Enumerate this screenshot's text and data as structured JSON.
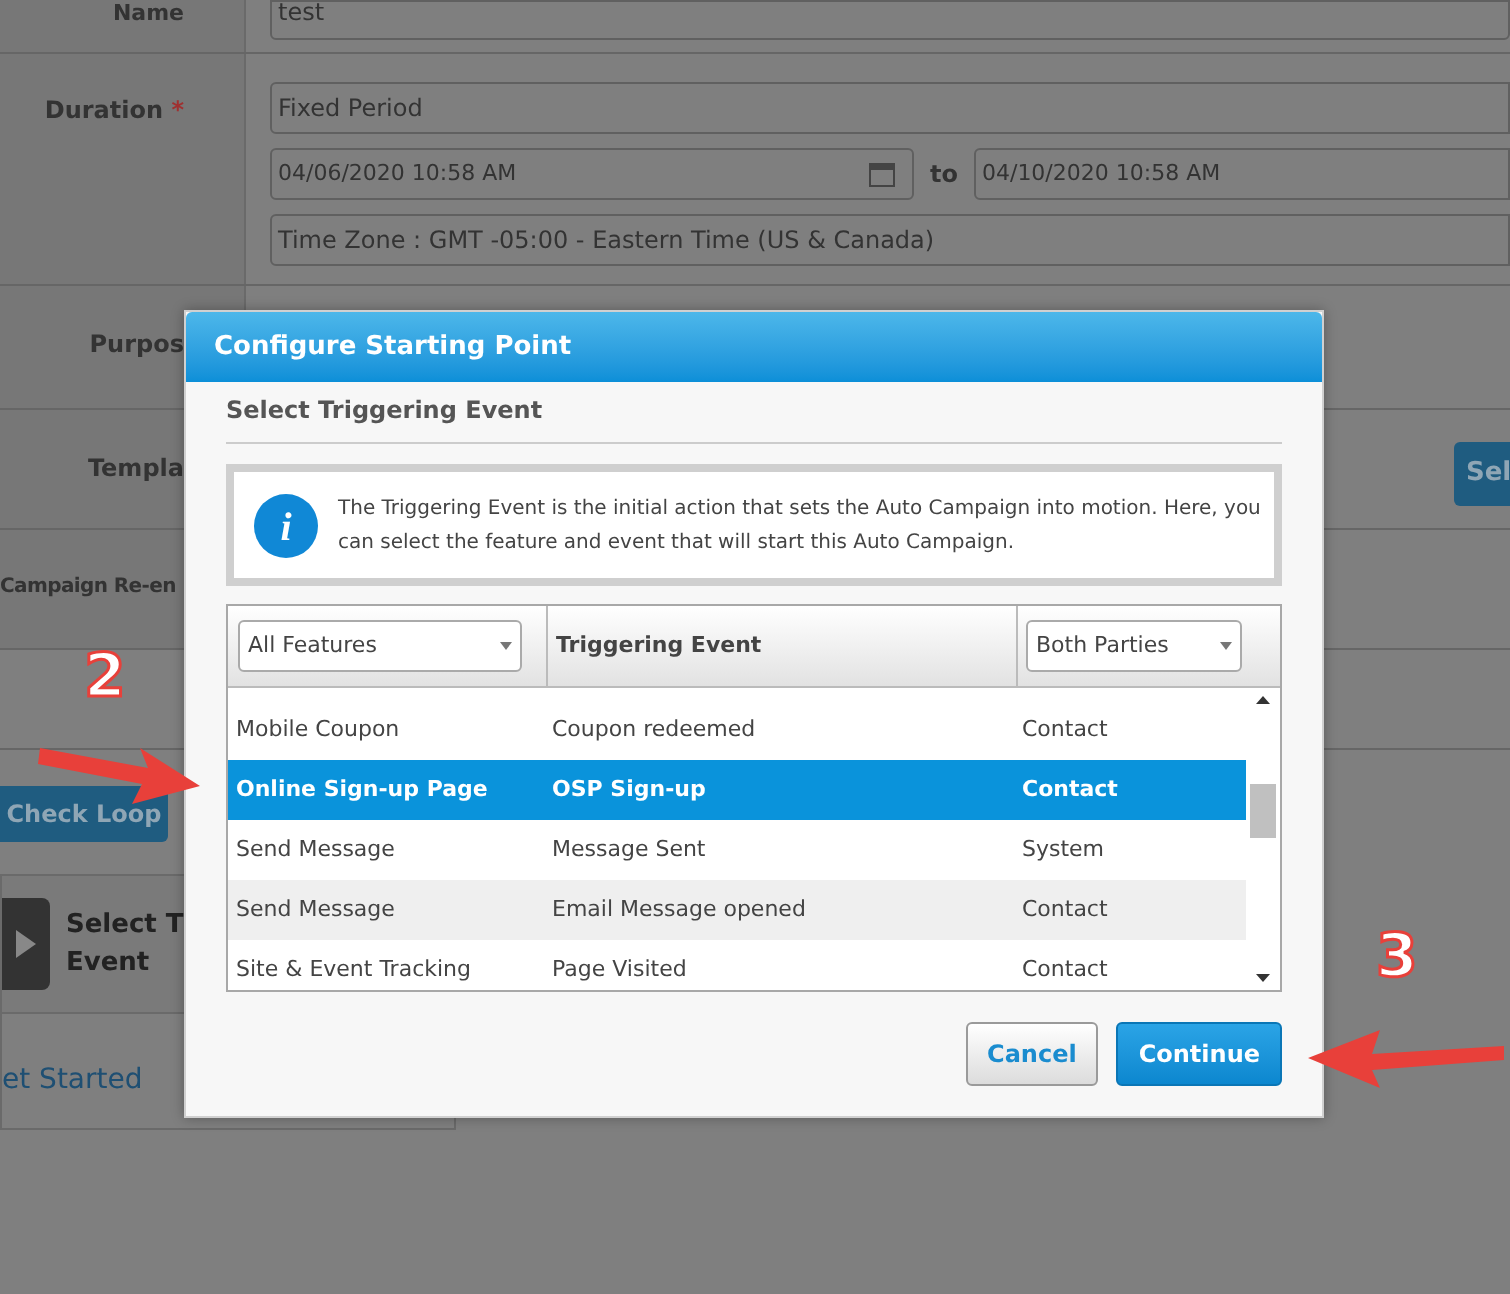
{
  "form": {
    "name": {
      "label": "Name",
      "value": "test"
    },
    "duration": {
      "label": "Duration",
      "required_mark": "*",
      "period": "Fixed Period",
      "start": "04/06/2020 10:58 AM",
      "separator": "to",
      "end": "04/10/2020 10:58 AM",
      "time_zone": "Time Zone : GMT -05:00 - Eastern Time (US & Canada)"
    },
    "purpose_label": "Purpos",
    "template_label": "Templa",
    "template_button": "Sel",
    "reentry_label": "Campaign Re-en",
    "check_loop_button": "Check Loop",
    "step_card": {
      "title_lines": [
        "Select T",
        "Event"
      ]
    },
    "get_started_link": "et Started"
  },
  "dialog": {
    "title": "Configure Starting Point",
    "section_title": "Select Triggering Event",
    "info_icon": "i",
    "info_text": "The Triggering Event is the initial action that sets the Auto Campaign into motion. Here, you can select the feature and event that will start this Auto Campaign.",
    "table": {
      "feature_filter": "All Features",
      "event_header": "Triggering Event",
      "party_filter": "Both Parties",
      "rows": [
        {
          "feature": "Mobile Coupon",
          "event": "Coupon redeemed",
          "party": "Contact",
          "selected": false
        },
        {
          "feature": "Online Sign-up Page",
          "event": "OSP Sign-up",
          "party": "Contact",
          "selected": true
        },
        {
          "feature": "Send Message",
          "event": "Message Sent",
          "party": "System",
          "selected": false
        },
        {
          "feature": "Send Message",
          "event": "Email Message opened",
          "party": "Contact",
          "selected": false
        },
        {
          "feature": "Site & Event Tracking",
          "event": "Page Visited",
          "party": "Contact",
          "selected": false
        }
      ]
    },
    "buttons": [
      {
        "label": "Cancel",
        "kind": "secondary"
      },
      {
        "label": "Continue",
        "kind": "primary"
      }
    ]
  },
  "annotations": [
    {
      "number": "2"
    },
    {
      "number": "3"
    }
  ]
}
